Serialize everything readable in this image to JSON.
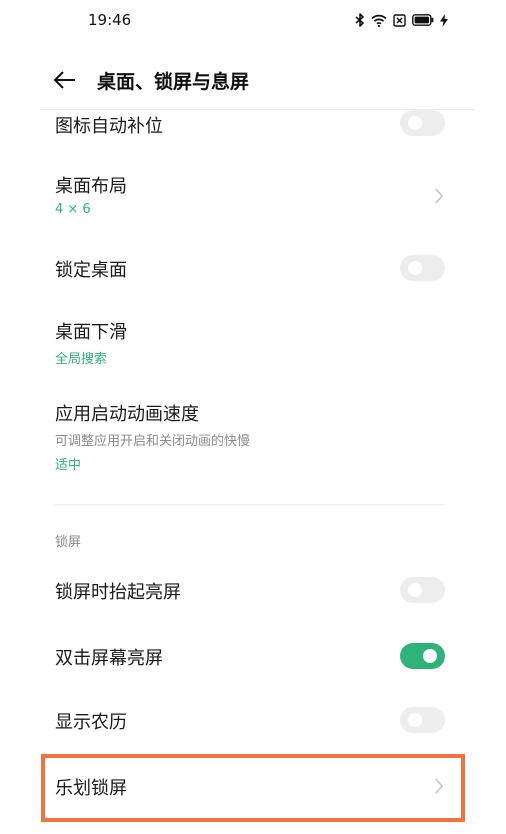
{
  "status_bar": {
    "time": "19:46",
    "icons": [
      "bluetooth-icon",
      "wifi-icon",
      "sim-icon",
      "battery-icon",
      "charging-icon"
    ]
  },
  "header": {
    "back_icon": "arrow-left-icon",
    "title": "桌面、锁屏与息屏"
  },
  "settings": {
    "icon_autofill": {
      "title": "图标自动补位",
      "enabled": false
    },
    "desktop_layout": {
      "title": "桌面布局",
      "value": "4 × 6"
    },
    "lock_desktop": {
      "title": "锁定桌面",
      "enabled": false
    },
    "swipe_down": {
      "title": "桌面下滑",
      "value": "全局搜索"
    },
    "launch_anim_speed": {
      "title": "应用启动动画速度",
      "summary": "可调整应用开启和关闭动画的快慢",
      "value": "适中"
    }
  },
  "lockscreen_section": {
    "header": "锁屏",
    "raise_to_wake": {
      "title": "锁屏时抬起亮屏",
      "enabled": false
    },
    "double_tap_wake": {
      "title": "双击屏幕亮屏",
      "enabled": true
    },
    "lunar_calendar": {
      "title": "显示农历",
      "enabled": false
    },
    "lehua_lockscreen": {
      "title": "乐划锁屏"
    }
  },
  "colors": {
    "accent": "#2fb37a",
    "highlight": "#f0743e",
    "switch_off": "#ededed"
  }
}
